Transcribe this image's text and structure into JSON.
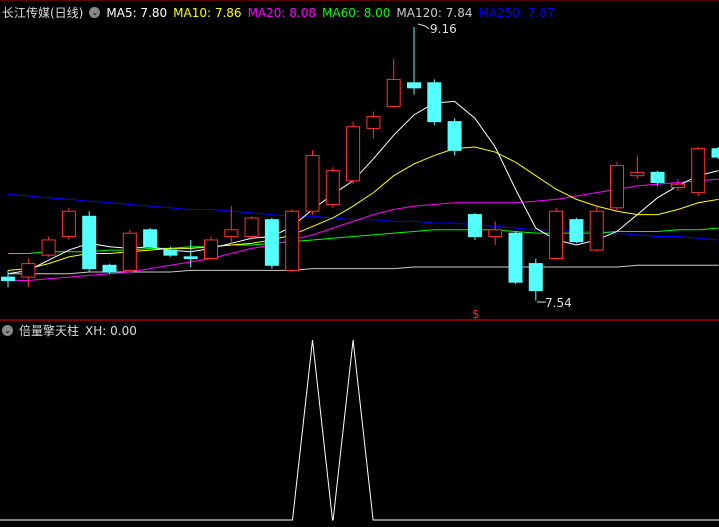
{
  "header": {
    "title": "长江传媒(日线)",
    "ma": [
      {
        "label": "MA5: 7.80",
        "color": "#ffffff"
      },
      {
        "label": "MA10: 7.86",
        "color": "#ffff00"
      },
      {
        "label": "MA20: 8.08",
        "color": "#ff00ff"
      },
      {
        "label": "MA60: 8.00",
        "color": "#00ff00"
      },
      {
        "label": "MA120: 7.84",
        "color": "#cccccc"
      },
      {
        "label": "MA250: 7.87",
        "color": "#0000ff"
      }
    ]
  },
  "annotations": {
    "high": "9.16",
    "low": "7.54",
    "marker": "$"
  },
  "indicator": {
    "title": "倍量擎天柱",
    "value": "XH: 0.00",
    "spikes_at_candle": [
      15,
      17
    ]
  },
  "colors": {
    "up": "#ff3232",
    "down": "#54ffff",
    "frame": "#b00000"
  },
  "candles": [
    [
      7.68,
      7.66,
      7.72,
      7.62
    ],
    [
      7.68,
      7.76,
      7.79,
      7.62
    ],
    [
      7.81,
      7.9,
      7.92,
      7.8
    ],
    [
      7.92,
      8.07,
      8.09,
      7.9
    ],
    [
      8.04,
      7.73,
      8.07,
      7.71
    ],
    [
      7.75,
      7.71,
      7.76,
      7.7
    ],
    [
      7.72,
      7.94,
      7.96,
      7.71
    ],
    [
      7.96,
      7.86,
      7.97,
      7.85
    ],
    [
      7.84,
      7.81,
      7.86,
      7.8
    ],
    [
      7.8,
      7.79,
      7.9,
      7.74
    ],
    [
      7.79,
      7.9,
      7.92,
      7.78
    ],
    [
      7.92,
      7.96,
      8.1,
      7.87
    ],
    [
      7.92,
      8.03,
      8.04,
      7.9
    ],
    [
      8.02,
      7.75,
      8.03,
      7.73
    ],
    [
      7.72,
      8.07,
      8.08,
      7.71
    ],
    [
      8.07,
      8.4,
      8.43,
      8.05
    ],
    [
      8.11,
      8.31,
      8.33,
      8.09
    ],
    [
      8.25,
      8.57,
      8.6,
      8.23
    ],
    [
      8.56,
      8.63,
      8.66,
      8.5
    ],
    [
      8.69,
      8.85,
      8.97,
      8.68
    ],
    [
      8.83,
      8.8,
      9.16,
      8.76
    ],
    [
      8.83,
      8.6,
      8.85,
      8.58
    ],
    [
      8.6,
      8.43,
      8.62,
      8.4
    ],
    [
      8.05,
      7.92,
      8.06,
      7.9
    ],
    [
      7.92,
      7.96,
      8.01,
      7.87
    ],
    [
      7.94,
      7.65,
      7.95,
      7.64
    ],
    [
      7.76,
      7.6,
      7.79,
      7.54
    ],
    [
      7.79,
      8.07,
      8.09,
      7.78
    ],
    [
      8.02,
      7.89,
      8.03,
      7.88
    ],
    [
      7.84,
      8.07,
      8.1,
      7.83
    ],
    [
      8.09,
      8.34,
      8.36,
      8.07
    ],
    [
      8.28,
      8.3,
      8.4,
      8.26
    ],
    [
      8.3,
      8.24,
      8.31,
      8.22
    ],
    [
      8.21,
      8.23,
      8.26,
      8.19
    ],
    [
      8.18,
      8.44,
      8.45,
      8.16
    ],
    [
      8.44,
      8.39,
      8.45,
      8.38
    ]
  ],
  "ma_series": {
    "ma5": [
      7.7,
      7.72,
      7.78,
      7.84,
      7.88,
      7.86,
      7.85,
      7.86,
      7.84,
      7.83,
      7.85,
      7.88,
      7.91,
      7.92,
      7.98,
      8.08,
      8.17,
      8.25,
      8.38,
      8.52,
      8.64,
      8.71,
      8.72,
      8.62,
      8.45,
      8.2,
      7.97,
      7.9,
      7.87,
      7.9,
      7.95,
      8.05,
      8.15,
      8.22,
      8.28,
      8.31
    ],
    "ma10": [
      7.72,
      7.73,
      7.76,
      7.8,
      7.82,
      7.82,
      7.83,
      7.84,
      7.85,
      7.85,
      7.86,
      7.87,
      7.88,
      7.9,
      7.93,
      7.98,
      8.03,
      8.1,
      8.18,
      8.28,
      8.35,
      8.4,
      8.44,
      8.45,
      8.42,
      8.36,
      8.28,
      8.2,
      8.14,
      8.1,
      8.07,
      8.05,
      8.05,
      8.08,
      8.12,
      8.14
    ],
    "ma20": [
      7.66,
      7.66,
      7.67,
      7.68,
      7.69,
      7.7,
      7.71,
      7.73,
      7.75,
      7.77,
      7.79,
      7.82,
      7.85,
      7.87,
      7.9,
      7.93,
      7.97,
      8.01,
      8.05,
      8.08,
      8.1,
      8.11,
      8.12,
      8.12,
      8.12,
      8.12,
      8.13,
      8.14,
      8.16,
      8.18,
      8.2,
      8.22,
      8.23,
      8.24,
      8.25,
      8.26
    ],
    "ma60": [
      7.82,
      7.82,
      7.83,
      7.83,
      7.83,
      7.84,
      7.84,
      7.85,
      7.85,
      7.86,
      7.86,
      7.87,
      7.87,
      7.88,
      7.89,
      7.9,
      7.91,
      7.92,
      7.93,
      7.94,
      7.95,
      7.96,
      7.96,
      7.96,
      7.96,
      7.95,
      7.94,
      7.94,
      7.94,
      7.94,
      7.95,
      7.95,
      7.95,
      7.96,
      7.96,
      7.97
    ],
    "ma120": [
      7.7,
      7.7,
      7.7,
      7.7,
      7.71,
      7.71,
      7.71,
      7.71,
      7.71,
      7.72,
      7.72,
      7.72,
      7.72,
      7.72,
      7.72,
      7.73,
      7.73,
      7.73,
      7.73,
      7.73,
      7.74,
      7.74,
      7.74,
      7.74,
      7.74,
      7.74,
      7.74,
      7.74,
      7.74,
      7.74,
      7.74,
      7.75,
      7.75,
      7.75,
      7.75,
      7.75
    ],
    "ma250": [
      8.17,
      8.16,
      8.15,
      8.14,
      8.13,
      8.12,
      8.11,
      8.1,
      8.09,
      8.08,
      8.08,
      8.07,
      8.06,
      8.05,
      8.04,
      8.04,
      8.03,
      8.02,
      8.02,
      8.01,
      8.01,
      8.0,
      8.0,
      7.99,
      7.98,
      7.97,
      7.96,
      7.96,
      7.95,
      7.95,
      7.94,
      7.93,
      7.92,
      7.92,
      7.91,
      7.9
    ]
  }
}
